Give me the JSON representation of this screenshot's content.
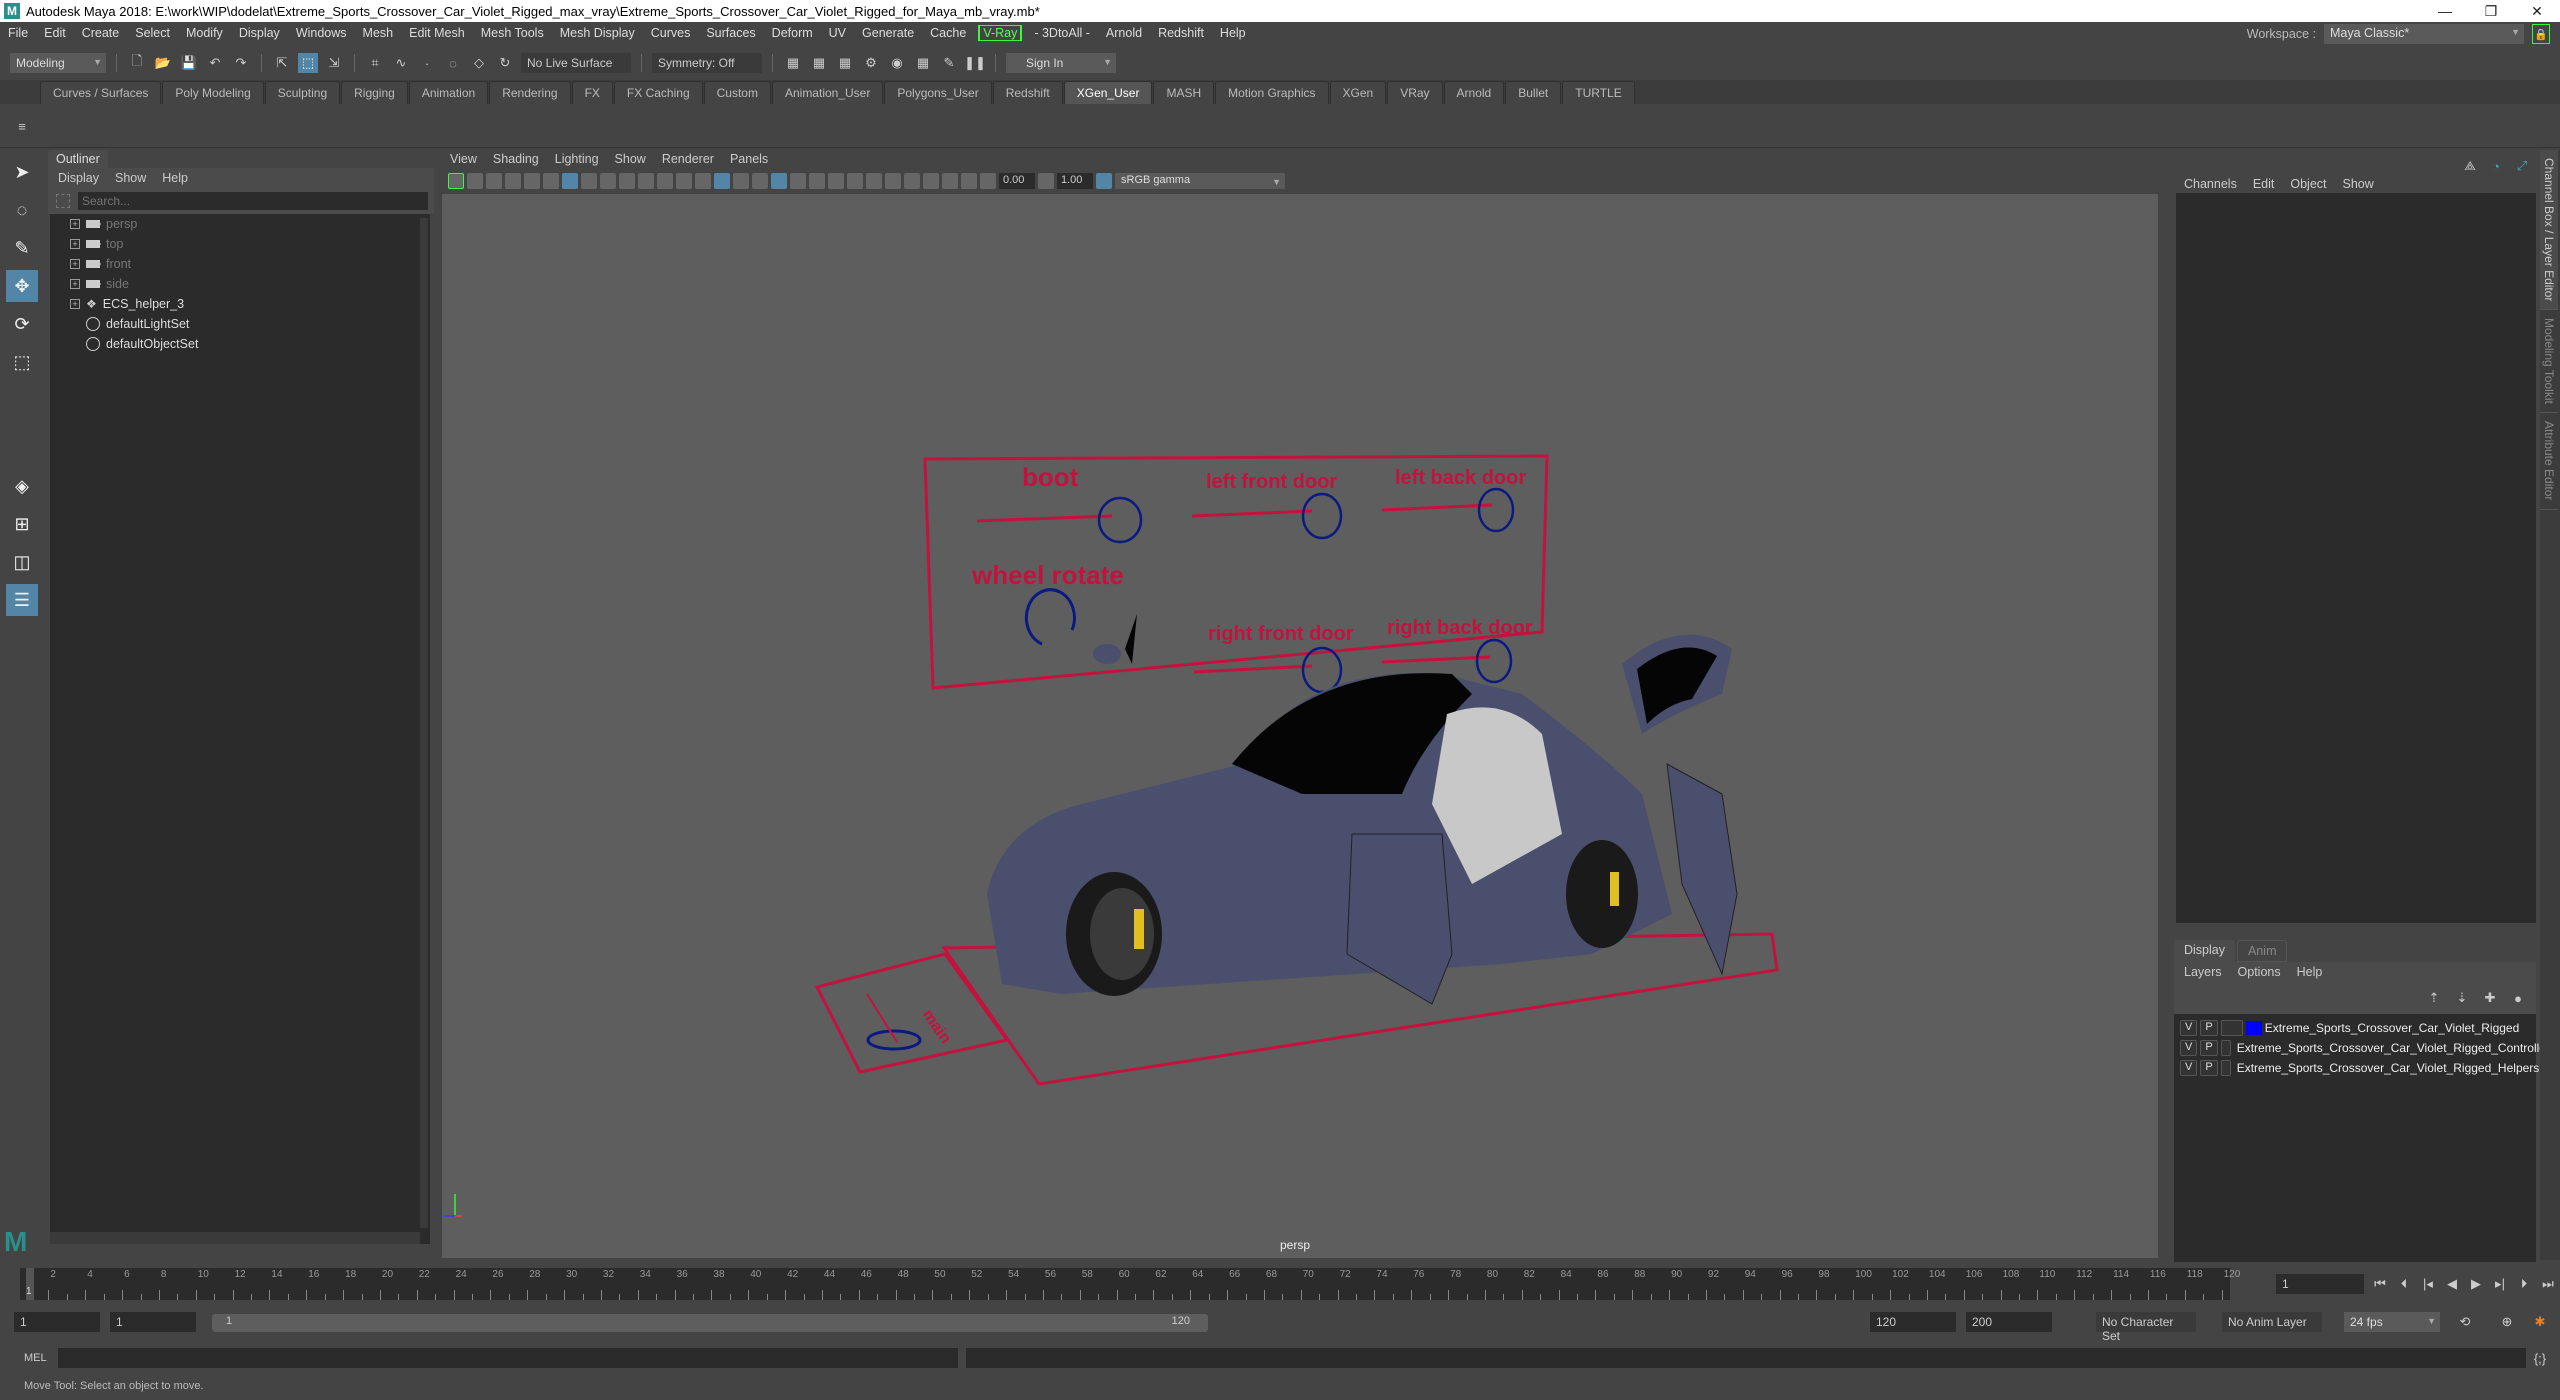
{
  "window": {
    "title": "Autodesk Maya 2018: E:\\work\\WIP\\dodelat\\Extreme_Sports_Crossover_Car_Violet_Rigged_max_vray\\Extreme_Sports_Crossover_Car_Violet_Rigged_for_Maya_mb_vray.mb*",
    "controls": {
      "minimize": "—",
      "restore": "❐",
      "close": "✕"
    }
  },
  "menubar": {
    "items": [
      "File",
      "Edit",
      "Create",
      "Select",
      "Modify",
      "Display",
      "Windows",
      "Mesh",
      "Edit Mesh",
      "Mesh Tools",
      "Mesh Display",
      "Curves",
      "Surfaces",
      "Deform",
      "UV",
      "Generate",
      "Cache"
    ],
    "vray": "V-Ray",
    "items2": [
      "- 3DtoAll -",
      "Arnold",
      "Redshift",
      "Help"
    ],
    "workspace_label": "Workspace :",
    "workspace_value": "Maya Classic*"
  },
  "statusline": {
    "mode": "Modeling",
    "live_surface": "No Live Surface",
    "symmetry": "Symmetry: Off",
    "sign_in": "Sign In"
  },
  "shelf": {
    "tabs": [
      "Curves / Surfaces",
      "Poly Modeling",
      "Sculpting",
      "Rigging",
      "Animation",
      "Rendering",
      "FX",
      "FX Caching",
      "Custom",
      "Animation_User",
      "Polygons_User",
      "Redshift",
      "XGen_User",
      "MASH",
      "Motion Graphics",
      "XGen",
      "VRay",
      "Arnold",
      "Bullet",
      "TURTLE"
    ],
    "active": "XGen_User"
  },
  "outliner": {
    "title": "Outliner",
    "menu": [
      "Display",
      "Show",
      "Help"
    ],
    "search_placeholder": "Search...",
    "items": [
      {
        "label": "persp",
        "icon": "camera-icon",
        "dim": true,
        "expandable": true
      },
      {
        "label": "top",
        "icon": "camera-icon",
        "dim": true,
        "expandable": true
      },
      {
        "label": "front",
        "icon": "camera-icon",
        "dim": true,
        "expandable": true
      },
      {
        "label": "side",
        "icon": "camera-icon",
        "dim": true,
        "expandable": true
      },
      {
        "label": "ECS_helper_3",
        "icon": "group-icon",
        "dim": false,
        "expandable": true
      },
      {
        "label": "defaultLightSet",
        "icon": "set-icon",
        "dim": false,
        "expandable": false
      },
      {
        "label": "defaultObjectSet",
        "icon": "set-icon",
        "dim": false,
        "expandable": false
      }
    ]
  },
  "viewport": {
    "menu": [
      "View",
      "Shading",
      "Lighting",
      "Show",
      "Renderer",
      "Panels"
    ],
    "exposure": "0.00",
    "gamma": "1.00",
    "color_space": "sRGB gamma",
    "camera": "persp",
    "controls": {
      "boot": "boot",
      "left_front_door": "left front door",
      "left_back_door": "left back door",
      "wheel_rotate": "wheel rotate",
      "right_front_door": "right front door",
      "right_back_door": "right back door",
      "ground_label": "main"
    },
    "colors": {
      "rig_red": "#c4123f",
      "rig_blue": "#0a1a80",
      "car_body": "#4a4f6e",
      "background": "#5e5e5e"
    }
  },
  "channelbox": {
    "menu": [
      "Channels",
      "Edit",
      "Object",
      "Show"
    ],
    "layer_tabs": [
      "Display",
      "Anim"
    ],
    "layer_menu": [
      "Layers",
      "Options",
      "Help"
    ],
    "layers": [
      {
        "v": "V",
        "p": "P",
        "color": "#0000ff",
        "name": "Extreme_Sports_Crossover_Car_Violet_Rigged"
      },
      {
        "v": "V",
        "p": "P",
        "color": "#000066",
        "name": "Extreme_Sports_Crossover_Car_Violet_Rigged_Controller"
      },
      {
        "v": "V",
        "p": "P",
        "color": "#990022",
        "name": "Extreme_Sports_Crossover_Car_Violet_Rigged_Helpers"
      }
    ]
  },
  "sidetabs": [
    "Channel Box / Layer Editor",
    "Modeling Toolkit",
    "Attribute Editor"
  ],
  "timeline": {
    "start": 1,
    "end": 120,
    "current": 1,
    "tick_labels_step": 2,
    "current_frame": "1"
  },
  "range": {
    "start_time": "1",
    "playback_start": "1",
    "slider_start": "1",
    "slider_end": "120",
    "playback_end": "120",
    "end_time": "200",
    "character_set": "No Character Set",
    "anim_layer": "No Anim Layer",
    "fps": "24 fps"
  },
  "cmdline": {
    "label": "MEL"
  },
  "helpline": {
    "text": "Move Tool: Select an object to move."
  }
}
